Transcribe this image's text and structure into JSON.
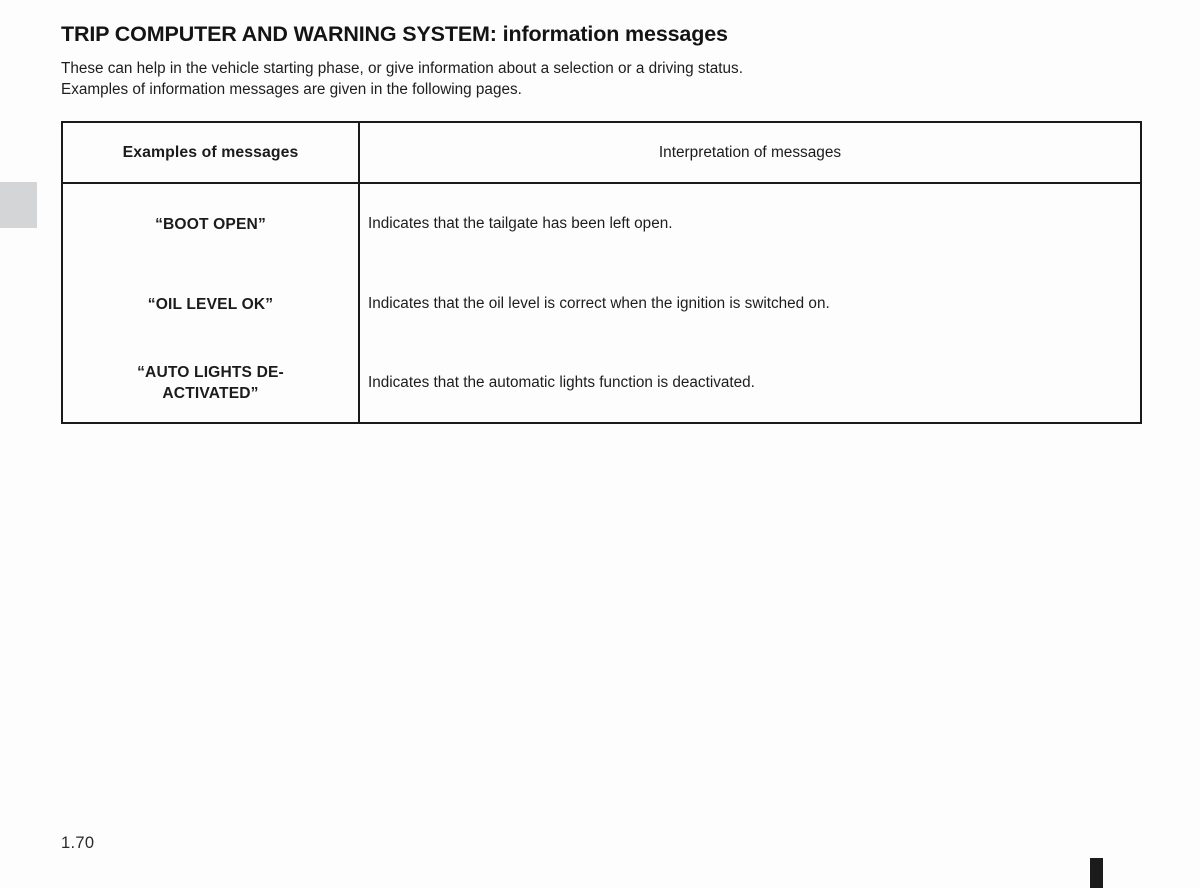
{
  "document": {
    "title": "TRIP COMPUTER AND WARNING SYSTEM: information messages",
    "intro_line_1": "These can help in the vehicle starting phase, or give information about a selection or a driving status.",
    "intro_line_2": "Examples of information messages are given in the following pages.",
    "page_number": "1.70"
  },
  "table": {
    "headers": {
      "left": "Examples of messages",
      "right": "Interpretation of messages"
    },
    "rows": [
      {
        "message": "“BOOT OPEN”",
        "interpretation": "Indicates that the tailgate has been left open."
      },
      {
        "message": "“OIL LEVEL OK”",
        "interpretation": "Indicates that the oil level is correct when the ignition is switched on."
      },
      {
        "message_line_1": "“AUTO LIGHTS DE-",
        "message_line_2": "ACTIVATED”",
        "interpretation": "Indicates that the automatic lights function is deactivated."
      }
    ]
  },
  "colors": {
    "page_background": "#fdfdfd",
    "text": "#1b1b1b",
    "table_border": "#1a1a1a",
    "chapter_tab": "#d3d5d7",
    "edge_marker": "#1b1b1b"
  }
}
